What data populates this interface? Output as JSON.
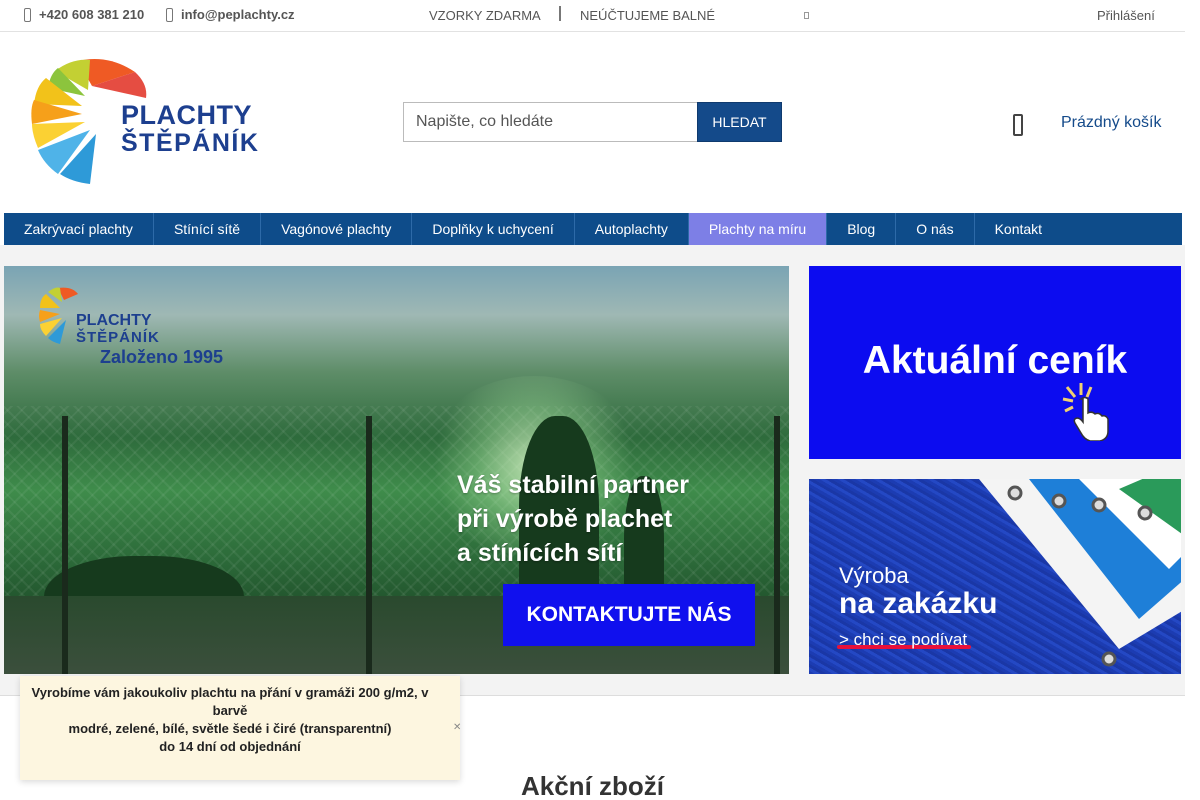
{
  "topbar": {
    "phone": "+420 608 381 210",
    "email": "info@peplachty.cz",
    "info1": "VZORKY ZDARMA",
    "info2": "NEÚČTUJEME BALNÉ",
    "login": "Přihlášení"
  },
  "logo": {
    "line1": "PLACHTY",
    "line2": "ŠTĚPÁNÍK"
  },
  "search": {
    "placeholder": "Napište, co hledáte",
    "button": "HLEDAT"
  },
  "cart": {
    "label": "Prázdný košík"
  },
  "nav": [
    "Zakrývací plachty",
    "Stínící sítě",
    "Vagónové plachty",
    "Doplňky k uchycení",
    "Autoplachty",
    "Plachty na míru",
    "Blog",
    "O nás",
    "Kontakt"
  ],
  "hero": {
    "logo_line1": "PLACHTY",
    "logo_line2": "ŠTĚPÁNÍK",
    "founded": "Založeno 1995",
    "slogan1": "Váš stabilní partner",
    "slogan2": "při výrobě plachet",
    "slogan3": "a stínících sítí",
    "cta": "KONTAKTUJTE NÁS"
  },
  "side_top": {
    "label": "Aktuální ceník"
  },
  "side_bottom": {
    "line1": "Výroba",
    "line2": "na zakázku",
    "line3": "> chci se podívat"
  },
  "notice": {
    "line1": "Vyrobíme vám jakoukoliv plachtu na přání v gramáži 200 g/m2, v barvě",
    "line2": "modré, zelené, bílé, světle šedé i čiré (transparentní)",
    "line3": "do 14 dní od objednání"
  },
  "section": {
    "title": "Akční zboží"
  },
  "colors": {
    "nav": "#0e4c8a",
    "nav_active": "#7d7fe6",
    "accent": "#144a8a",
    "banner_blue": "#0c0cf0"
  }
}
